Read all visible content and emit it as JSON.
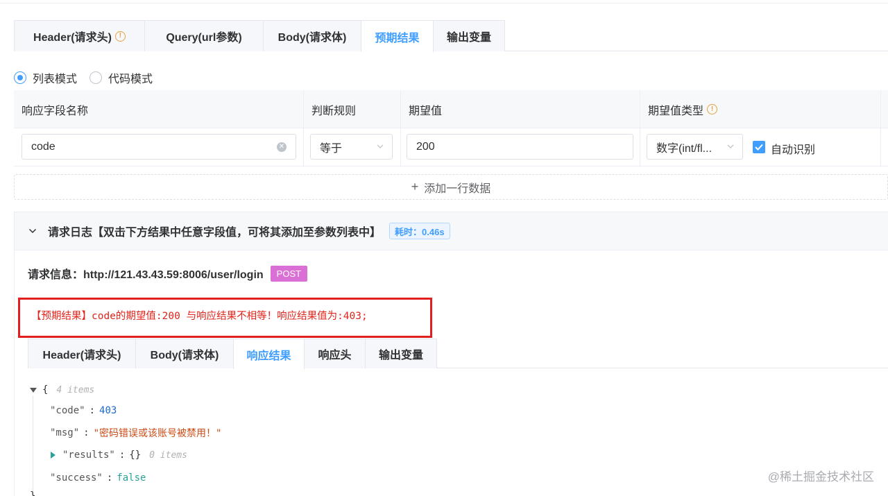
{
  "top_tabs": [
    {
      "label": "Header(请求头)",
      "active": false,
      "warning": true
    },
    {
      "label": "Query(url参数)",
      "active": false
    },
    {
      "label": "Body(请求体)",
      "active": false
    },
    {
      "label": "预期结果",
      "active": true
    },
    {
      "label": "输出变量",
      "active": false
    }
  ],
  "modes": {
    "list": "列表模式",
    "code": "代码模式",
    "selected": "列表模式"
  },
  "table": {
    "headers": {
      "field": "响应字段名称",
      "rule": "判断规则",
      "expected": "期望值",
      "type": "期望值类型"
    },
    "row": {
      "field": "code",
      "rule": "等于",
      "expected": "200",
      "type": "数字(int/fl...",
      "auto_label": "自动识别",
      "auto_checked": true
    },
    "add_row": "添加一行数据"
  },
  "log": {
    "title": "请求日志【双击下方结果中任意字段值，可将其添加至参数列表中】",
    "time": "耗时：0.46s",
    "req_info_label": "请求信息：http://121.43.43.59:8006/user/login",
    "method": "POST",
    "error": "【预期结果】code的期望值:200 与响应结果不相等！响应结果值为:403;"
  },
  "result_tabs": [
    {
      "label": "Header(请求头)",
      "active": false
    },
    {
      "label": "Body(请求体)",
      "active": false
    },
    {
      "label": "响应结果",
      "active": true
    },
    {
      "label": "响应头",
      "active": false
    },
    {
      "label": "输出变量",
      "active": false
    }
  ],
  "json_view": {
    "open_brace": "{",
    "count": "4 items",
    "code_key": "\"code\"",
    "code_val": "403",
    "msg_key": "\"msg\"",
    "msg_val": "\"密码错误或该账号被禁用！\"",
    "results_key": "\"results\"",
    "results_val": "{}",
    "results_count": "0 items",
    "success_key": "\"success\"",
    "success_val": "false",
    "close_brace": "}"
  },
  "watermark": "@稀土掘金技术社区",
  "colors": {
    "accent": "#409eff",
    "error": "#e2231a",
    "method_badge": "#da70d6",
    "warning": "#e6a23c"
  }
}
